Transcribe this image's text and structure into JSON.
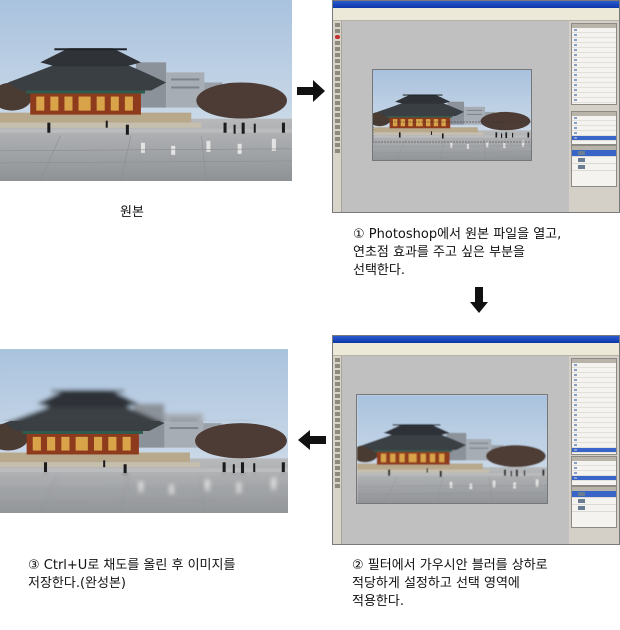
{
  "captions": {
    "original": "원본",
    "step1": "① Photoshop에서 원본 파일을 열고,\n연초점 효과를 주고 싶은 부분을\n선택한다.",
    "step2": "② 필터에서 가우시안 블러를 상하로\n적당하게 설정하고 선택 영역에\n적용한다.",
    "step3": "③ Ctrl+U로 채도를 올린 후 이미지를\n저장한다.(완성본)"
  },
  "arrows": [
    "arrow-right-icon",
    "arrow-down-icon",
    "arrow-left-icon"
  ],
  "colors": {
    "sky": "#b9cde3",
    "ground": "#a3a6a9",
    "roof": "#3a3f44",
    "palace_wall": "#8e3a1d",
    "highlight_blue": "#3a65c8"
  }
}
